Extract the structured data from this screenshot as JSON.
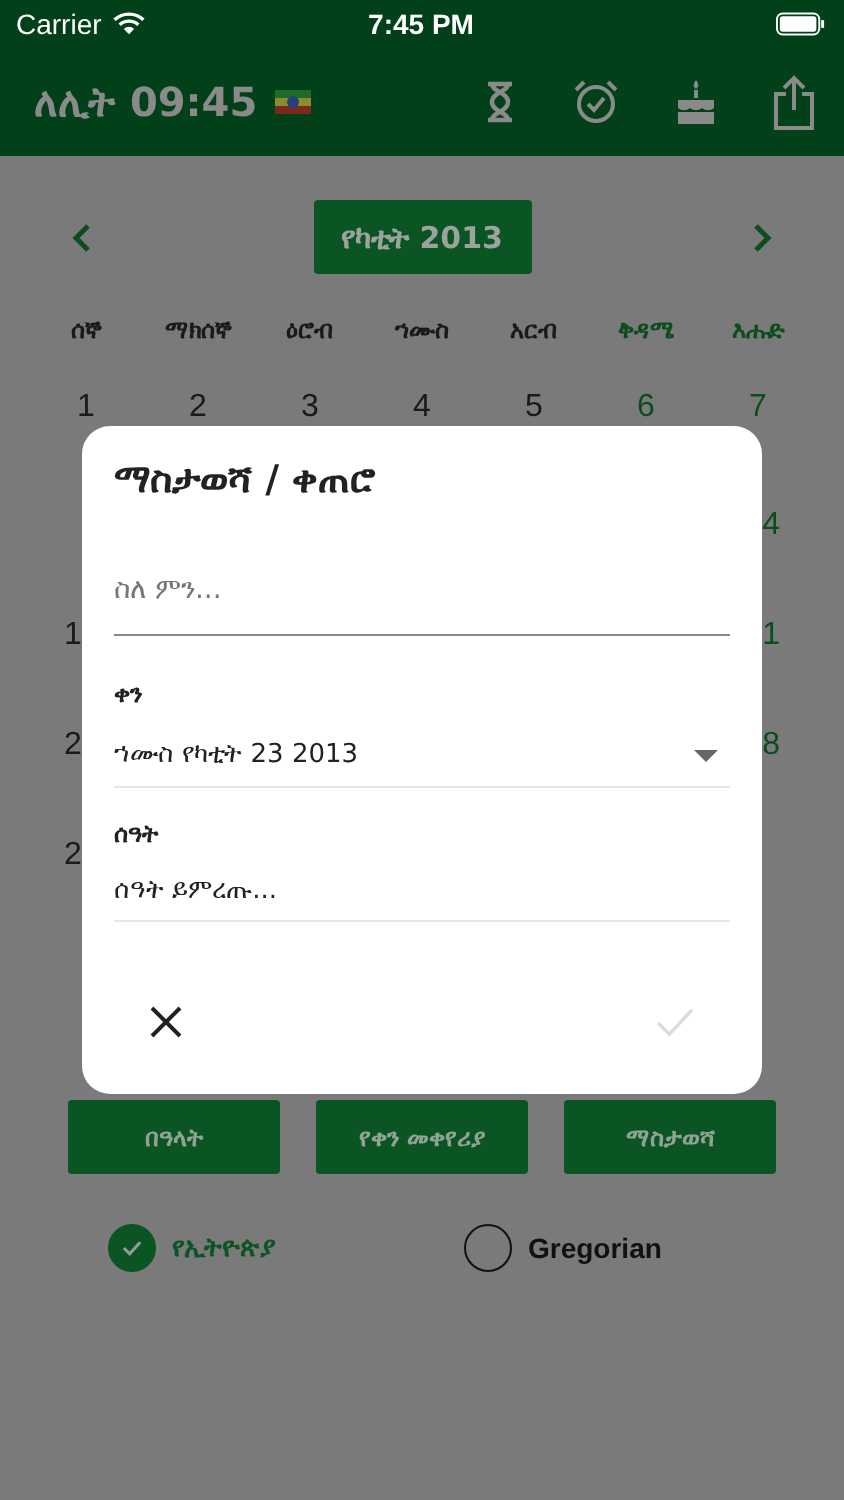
{
  "status_bar": {
    "carrier": "Carrier",
    "time": "7:45 PM"
  },
  "header": {
    "title": "ለሊት 09:45"
  },
  "calendar": {
    "month": "የካቲት 2013",
    "weekdays": [
      {
        "label": "ሰኞ",
        "weekend": false
      },
      {
        "label": "ማክሰኞ",
        "weekend": false
      },
      {
        "label": "ዕሮብ",
        "weekend": false
      },
      {
        "label": "ኀሙስ",
        "weekend": false
      },
      {
        "label": "አርብ",
        "weekend": false
      },
      {
        "label": "ቅዳሜ",
        "weekend": true
      },
      {
        "label": "እሑድ",
        "weekend": true
      }
    ],
    "first_week": [
      "1",
      "2",
      "3",
      "4",
      "5",
      "6",
      "7"
    ],
    "partial_weeks": [
      {
        "last": "4"
      },
      {
        "first": "1",
        "last": "1"
      },
      {
        "first": "2",
        "last": "8"
      },
      {
        "first": "2"
      }
    ]
  },
  "buttons": [
    "በዓላት",
    "የቀን መቀየሪያ",
    "ማስታወሻ"
  ],
  "calendar_options": [
    {
      "label": "የኢትዮጵያ",
      "selected": true
    },
    {
      "label": "Gregorian",
      "selected": false
    }
  ],
  "dialog": {
    "title": "ማስታወሻ / ቀጠሮ",
    "fields": [
      {
        "kind": "text",
        "placeholder": "ስለ ምን..."
      },
      {
        "kind": "dropdown",
        "label": "ቀን",
        "value": "ኀሙስ የካቲት 23 2013"
      },
      {
        "kind": "picker",
        "label": "ሰዓት",
        "value": "ሰዓት ይምረጡ..."
      }
    ],
    "confirm_disabled": true
  }
}
